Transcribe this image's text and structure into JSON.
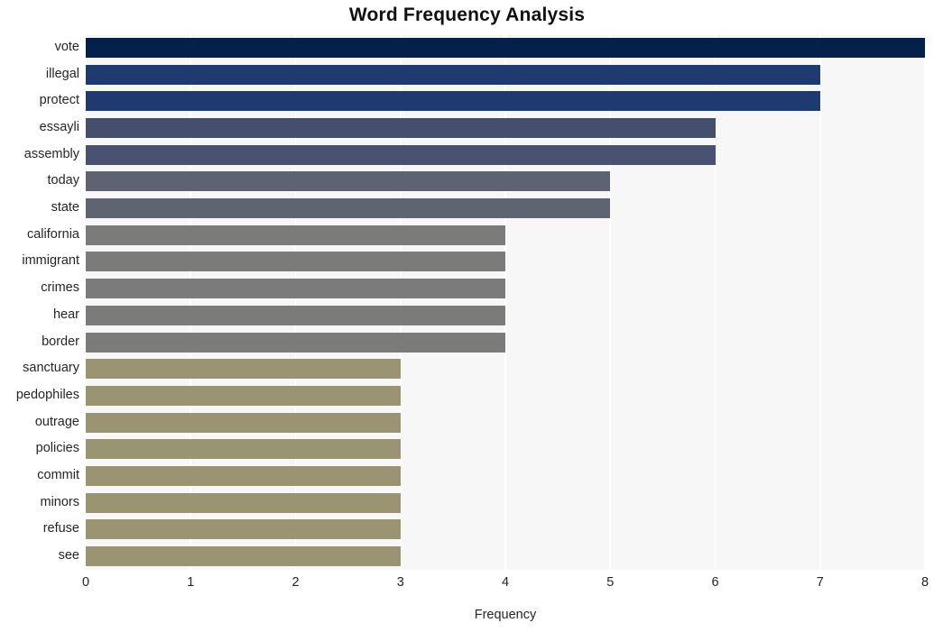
{
  "chart_data": {
    "type": "bar",
    "orientation": "horizontal",
    "title": "Word Frequency Analysis",
    "xlabel": "Frequency",
    "ylabel": "",
    "xlim": [
      0,
      8
    ],
    "xticks": [
      0,
      1,
      2,
      3,
      4,
      5,
      6,
      7,
      8
    ],
    "grid": true,
    "legend": null,
    "categories": [
      "vote",
      "illegal",
      "protect",
      "essayli",
      "assembly",
      "today",
      "state",
      "california",
      "immigrant",
      "crimes",
      "hear",
      "border",
      "sanctuary",
      "pedophiles",
      "outrage",
      "policies",
      "commit",
      "minors",
      "refuse",
      "see"
    ],
    "values": [
      8,
      7,
      7,
      6,
      6,
      5,
      5,
      4,
      4,
      4,
      4,
      4,
      3,
      3,
      3,
      3,
      3,
      3,
      3,
      3
    ],
    "bar_colors": [
      "#05204a",
      "#1e3a6e",
      "#1e3a71",
      "#454f6d",
      "#4a5274",
      "#5d6372",
      "#5e6471",
      "#7b7b79",
      "#7b7b79",
      "#7b7b79",
      "#7b7b79",
      "#7b7b79",
      "#9a9473",
      "#9a9473",
      "#9a9473",
      "#9a9473",
      "#9a9473",
      "#9a9473",
      "#9a9473",
      "#9a9473"
    ]
  },
  "style": {
    "plot_background": "#f7f7f7",
    "figure_background": "#ffffff",
    "gridline_color": "#ffffff",
    "tick_label_color": "#262626",
    "title_color": "#111111"
  }
}
